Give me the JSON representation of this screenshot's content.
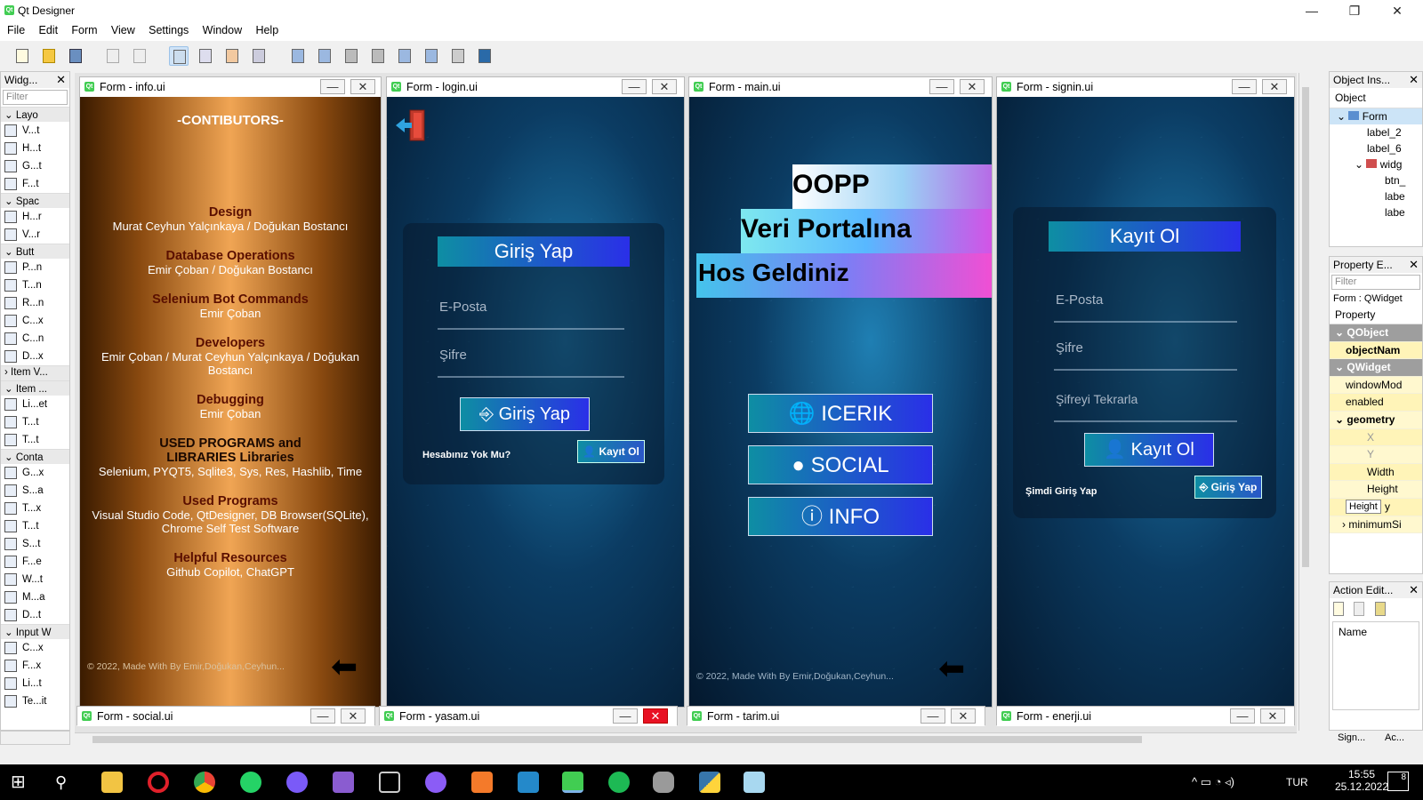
{
  "window": {
    "title": "Qt Designer",
    "min": "—",
    "max": "❐",
    "close": "✕"
  },
  "menu": [
    "File",
    "Edit",
    "Form",
    "View",
    "Settings",
    "Window",
    "Help"
  ],
  "widget_box": {
    "title": "Widg...",
    "filter_placeholder": "Filter",
    "categories": [
      "Layo",
      "Spac",
      "Butt",
      "Item V...",
      "Item ...",
      "Conta",
      "Input W"
    ],
    "layouts": [
      "V...t",
      "H...t",
      "G...t",
      "F...t"
    ],
    "spacers": [
      "H...r",
      "V...r"
    ],
    "buttons": [
      "P...n",
      "T...n",
      "R...n",
      "C...x",
      "C...n",
      "D...x"
    ],
    "item_widgets": [
      "Li...et",
      "T...t",
      "T...t"
    ],
    "containers": [
      "G...x",
      "S...a",
      "T...x",
      "T...t",
      "S...t",
      "F...e",
      "W...t",
      "M...a",
      "D...t"
    ],
    "inputs": [
      "C...x",
      "F...x",
      "Li...t",
      "Te...it"
    ]
  },
  "forms": {
    "info": {
      "title": "Form - info.ui",
      "heading": "-CONTIBUTORS-",
      "sections": [
        {
          "head": "Design",
          "text": "Murat Ceyhun Yalçınkaya / Doğukan Bostancı"
        },
        {
          "head": "Database Operations",
          "text": "Emir Çoban / Doğukan Bostancı"
        },
        {
          "head": "Selenium Bot Commands",
          "text": "Emir Çoban"
        },
        {
          "head": "Developers",
          "text": "Emir Çoban / Murat Ceyhun Yalçınkaya / Doğukan Bostancı"
        },
        {
          "head": "Debugging",
          "text": "Emir Çoban"
        },
        {
          "head": "USED PROGRAMS and LIBRARIES Libraries",
          "text": "Selenium, PYQT5, Sqlite3, Sys, Res, Hashlib, Time"
        },
        {
          "head": "Used Programs",
          "text": "Visual Studio Code, QtDesigner, DB Browser(SQLite), Chrome Self Test Software"
        },
        {
          "head": "Helpful Resources",
          "text": "Github Copilot, ChatGPT"
        }
      ],
      "footer": "© 2022, Made With By Emir,Doğukan,Ceyhun..."
    },
    "login": {
      "title": "Form - login.ui",
      "heading": "Giriş Yap",
      "email_placeholder": "E-Posta",
      "password_placeholder": "Şifre",
      "login_button": "Giriş Yap",
      "no_account": "Hesabınız Yok Mu?",
      "register_button": "Kayıt Ol"
    },
    "main": {
      "title": "Form - main.ui",
      "line1": "OOPP",
      "line2": "Veri Portalına",
      "line3": "Hos Geldiniz",
      "buttons": [
        "ICERIK",
        "SOCIAL",
        "INFO"
      ],
      "footer": "© 2022, Made With By Emir,Doğukan,Ceyhun..."
    },
    "signin": {
      "title": "Form - signin.ui",
      "heading": "Kayıt Ol",
      "email_placeholder": "E-Posta",
      "password_placeholder": "Şifre",
      "repeat_placeholder": "Şifreyi Tekrarla",
      "register_button": "Kayıt Ol",
      "login_now": "Şimdi Giriş Yap",
      "login_button": "Giriş Yap"
    },
    "minimized": [
      "Form - social.ui",
      "Form - yasam.ui",
      "Form - tarim.ui",
      "Form - enerji.ui"
    ]
  },
  "object_inspector": {
    "title": "Object Ins...",
    "column": "Object",
    "items": [
      "Form",
      "label_2",
      "label_6",
      "widg",
      "btn_",
      "labe",
      "labe"
    ]
  },
  "property_editor": {
    "title": "Property E...",
    "filter_placeholder": "Filter",
    "class_label": "Form : QWidget",
    "column": "Property",
    "rows": [
      "QObject",
      "objectNam",
      "QWidget",
      "windowMod",
      "enabled",
      "geometry",
      "X",
      "Y",
      "Width",
      "Height",
      "y",
      "minimumSi"
    ],
    "tooltip": "Height"
  },
  "action_editor": {
    "title": "Action Edit...",
    "column": "Name"
  },
  "bottom_tabs": [
    "Sign...",
    "Ac..."
  ],
  "taskbar": {
    "lang": "TUR",
    "time": "15:55",
    "date": "25.12.2022",
    "notifications": "8"
  },
  "colors": {
    "accent": "#41cd52",
    "tech_bg": "#0b3c63",
    "gold": "#f0a554",
    "button_grad_start": "#0e8ea3",
    "button_grad_end": "#2a2fe8"
  }
}
